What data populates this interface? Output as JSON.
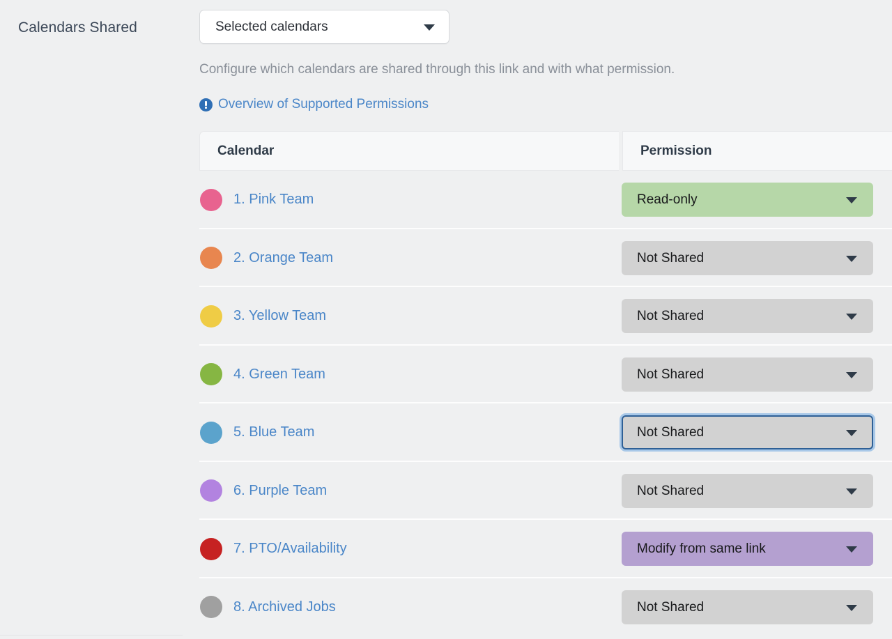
{
  "field": {
    "label": "Calendars Shared",
    "select_value": "Selected calendars",
    "help_text": "Configure which calendars are shared through this link and with what permission.",
    "link_text": "Overview of Supported Permissions",
    "info_icon": "info-circle-icon",
    "caret_icon": "chevron-down-icon"
  },
  "table": {
    "columns": [
      "Calendar",
      "Permission"
    ],
    "rows": [
      {
        "name": "1. Pink Team",
        "color": "#e8638f",
        "permission": "Read-only",
        "style": "green",
        "focused": false
      },
      {
        "name": "2. Orange Team",
        "color": "#e8864f",
        "permission": "Not Shared",
        "style": "gray",
        "focused": false
      },
      {
        "name": "3. Yellow Team",
        "color": "#efcc45",
        "permission": "Not Shared",
        "style": "gray",
        "focused": false
      },
      {
        "name": "4. Green Team",
        "color": "#86b643",
        "permission": "Not Shared",
        "style": "gray",
        "focused": false
      },
      {
        "name": "5. Blue Team",
        "color": "#5ba3cc",
        "permission": "Not Shared",
        "style": "gray",
        "focused": true
      },
      {
        "name": "6. Purple Team",
        "color": "#b283e0",
        "permission": "Not Shared",
        "style": "gray",
        "focused": false
      },
      {
        "name": "7. PTO/Availability",
        "color": "#c62222",
        "permission": "Modify from same link",
        "style": "purple",
        "focused": false
      },
      {
        "name": "8. Archived Jobs",
        "color": "#a0a0a0",
        "permission": "Not Shared",
        "style": "gray",
        "focused": false
      }
    ]
  },
  "colors": {
    "page_background": "#eff0f1",
    "link": "#4a86c8",
    "header_background": "#f7f8f9",
    "permission_default": "#d2d2d2",
    "permission_readonly": "#b6d7a8",
    "permission_modify": "#b4a0d0",
    "focus_ring": "#2f6096"
  }
}
